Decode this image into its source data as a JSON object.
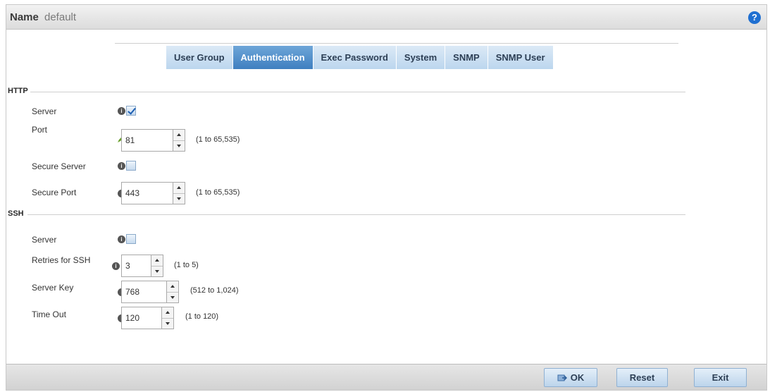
{
  "header": {
    "name_label": "Name",
    "name_value": "default",
    "help_icon": "help-icon",
    "help_glyph": "?"
  },
  "tabs": [
    {
      "label": "User Group",
      "active": false
    },
    {
      "label": "Authentication",
      "active": true
    },
    {
      "label": "Exec Password",
      "active": false
    },
    {
      "label": "System",
      "active": false
    },
    {
      "label": "SNMP",
      "active": false
    },
    {
      "label": "SNMP User",
      "active": false
    }
  ],
  "http": {
    "title": "HTTP",
    "server": {
      "label": "Server",
      "checked": true
    },
    "port": {
      "label": "Port",
      "value": "81",
      "range": "(1 to 65,535)"
    },
    "secure_server": {
      "label": "Secure Server",
      "checked": false
    },
    "secure_port": {
      "label": "Secure Port",
      "value": "443",
      "range": "(1 to 65,535)"
    }
  },
  "ssh": {
    "title": "SSH",
    "server": {
      "label": "Server",
      "checked": false
    },
    "retries": {
      "label": "Retries for SSH",
      "value": "3",
      "range": "(1 to 5)"
    },
    "server_key": {
      "label": "Server Key",
      "value": "768",
      "range": "(512 to 1,024)"
    },
    "time_out": {
      "label": "Time Out",
      "value": "120",
      "range": "(1 to 120)"
    }
  },
  "footer": {
    "ok_label": "OK",
    "reset_label": "Reset",
    "exit_label": "Exit"
  },
  "colors": {
    "active_tab": "#3f7fc0",
    "tab": "#bcd6ee",
    "help": "#1f6fd1"
  }
}
